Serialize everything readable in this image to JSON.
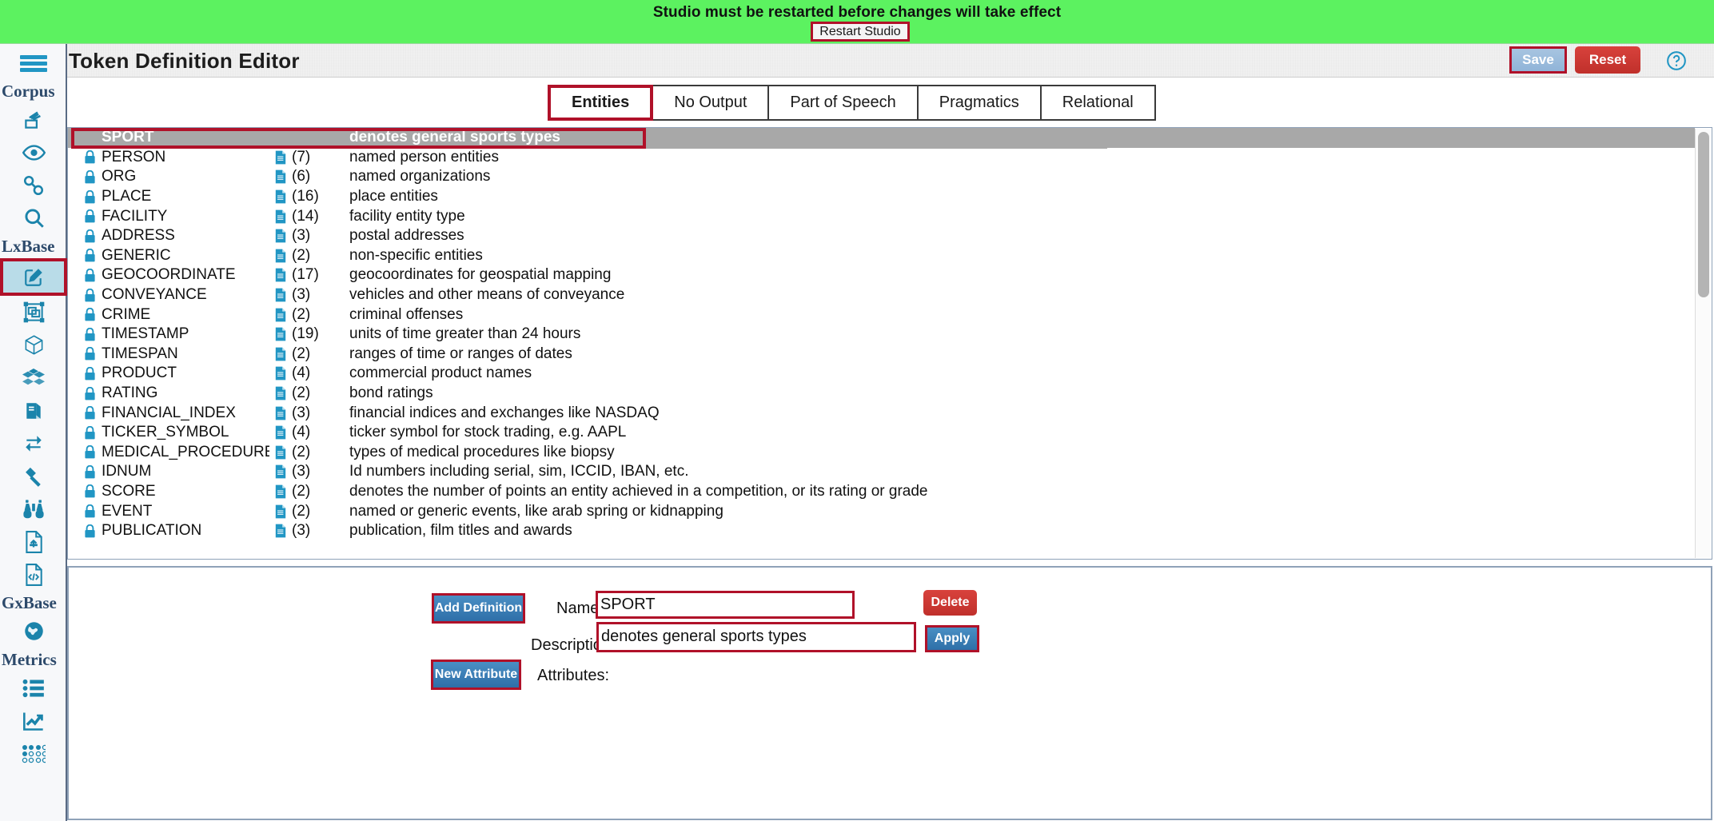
{
  "banner": {
    "message": "Studio must be restarted before changes will take effect",
    "restart_label": "Restart Studio",
    "bg_color": "#5cf260"
  },
  "header": {
    "title": "Token Definition Editor",
    "save_label": "Save",
    "reset_label": "Reset",
    "help_icon": "help-circle-icon"
  },
  "sidebar": {
    "menu_icon": "hamburger-menu-icon",
    "groups": [
      {
        "label": "Corpus",
        "items": [
          {
            "icon": "document-lines-icon",
            "name": "corpus-documents"
          },
          {
            "icon": "eye-icon",
            "name": "corpus-view"
          },
          {
            "icon": "link-chain-icon",
            "name": "corpus-links"
          },
          {
            "icon": "magnifier-icon",
            "name": "corpus-search"
          }
        ]
      },
      {
        "label": "LxBase",
        "items": [
          {
            "icon": "pencil-edit-icon",
            "name": "token-definition-editor"
          },
          {
            "icon": "layers-select-icon",
            "name": "lxbase-layers"
          },
          {
            "icon": "box-3d-icon",
            "name": "lxbase-package"
          },
          {
            "icon": "blocks-icon",
            "name": "lxbase-blocks"
          },
          {
            "icon": "book-icon",
            "name": "lxbase-lexicon"
          },
          {
            "icon": "sync-arrows-icon",
            "name": "lxbase-sync"
          },
          {
            "icon": "gavel-icon",
            "name": "lxbase-rules"
          },
          {
            "icon": "binoculars-icon",
            "name": "lxbase-inspect"
          },
          {
            "icon": "file-upload-icon",
            "name": "lxbase-import"
          },
          {
            "icon": "file-code-icon",
            "name": "lxbase-code"
          }
        ]
      },
      {
        "label": "GxBase",
        "items": [
          {
            "icon": "globe-icon",
            "name": "gxbase-globe"
          }
        ]
      },
      {
        "label": "Metrics",
        "items": [
          {
            "icon": "list-icon",
            "name": "metrics-list"
          },
          {
            "icon": "chart-line-icon",
            "name": "metrics-chart"
          },
          {
            "icon": "dots-grid-icon",
            "name": "metrics-grid"
          }
        ]
      }
    ],
    "active_item": "token-definition-editor"
  },
  "tabs": [
    {
      "label": "Entities",
      "active": true
    },
    {
      "label": "No Output",
      "active": false
    },
    {
      "label": "Part of Speech",
      "active": false
    },
    {
      "label": "Pragmatics",
      "active": false
    },
    {
      "label": "Relational",
      "active": false
    }
  ],
  "definition_list": {
    "lock_icon": "lock-icon",
    "doc_icon": "document-icon",
    "selected_index": 0,
    "rows": [
      {
        "name": "SPORT",
        "count": "",
        "description": "denotes general sports types",
        "selected": true,
        "locked": false,
        "has_doc": false
      },
      {
        "name": "PERSON",
        "count": "(7)",
        "description": "named person entities",
        "selected": false,
        "locked": true,
        "has_doc": true
      },
      {
        "name": "ORG",
        "count": "(6)",
        "description": "named organizations",
        "selected": false,
        "locked": true,
        "has_doc": true
      },
      {
        "name": "PLACE",
        "count": "(16)",
        "description": "place entities",
        "selected": false,
        "locked": true,
        "has_doc": true
      },
      {
        "name": "FACILITY",
        "count": "(14)",
        "description": "facility entity type",
        "selected": false,
        "locked": true,
        "has_doc": true
      },
      {
        "name": "ADDRESS",
        "count": "(3)",
        "description": "postal addresses",
        "selected": false,
        "locked": true,
        "has_doc": true
      },
      {
        "name": "GENERIC",
        "count": "(2)",
        "description": "non-specific entities",
        "selected": false,
        "locked": true,
        "has_doc": true
      },
      {
        "name": "GEOCOORDINATE",
        "count": "(17)",
        "description": "geocoordinates for geospatial mapping",
        "selected": false,
        "locked": true,
        "has_doc": true
      },
      {
        "name": "CONVEYANCE",
        "count": "(3)",
        "description": "vehicles and other means of conveyance",
        "selected": false,
        "locked": true,
        "has_doc": true
      },
      {
        "name": "CRIME",
        "count": "(2)",
        "description": "criminal offenses",
        "selected": false,
        "locked": true,
        "has_doc": true
      },
      {
        "name": "TIMESTAMP",
        "count": "(19)",
        "description": "units of time greater than 24 hours",
        "selected": false,
        "locked": true,
        "has_doc": true
      },
      {
        "name": "TIMESPAN",
        "count": "(2)",
        "description": "ranges of time or ranges of dates",
        "selected": false,
        "locked": true,
        "has_doc": true
      },
      {
        "name": "PRODUCT",
        "count": "(4)",
        "description": "commercial product names",
        "selected": false,
        "locked": true,
        "has_doc": true
      },
      {
        "name": "RATING",
        "count": "(2)",
        "description": "bond ratings",
        "selected": false,
        "locked": true,
        "has_doc": true
      },
      {
        "name": "FINANCIAL_INDEX",
        "count": "(3)",
        "description": "financial indices and exchanges like NASDAQ",
        "selected": false,
        "locked": true,
        "has_doc": true
      },
      {
        "name": "TICKER_SYMBOL",
        "count": "(4)",
        "description": "ticker symbol for stock trading, e.g. AAPL",
        "selected": false,
        "locked": true,
        "has_doc": true
      },
      {
        "name": "MEDICAL_PROCEDURE",
        "count": "(2)",
        "description": "types of medical procedures like biopsy",
        "selected": false,
        "locked": true,
        "has_doc": true
      },
      {
        "name": "IDNUM",
        "count": "(3)",
        "description": "Id numbers including serial, sim, ICCID, IBAN, etc.",
        "selected": false,
        "locked": true,
        "has_doc": true
      },
      {
        "name": "SCORE",
        "count": "(2)",
        "description": "denotes the number of points an entity achieved in a competition, or its rating or grade",
        "selected": false,
        "locked": true,
        "has_doc": true
      },
      {
        "name": "EVENT",
        "count": "(2)",
        "description": "named or generic events, like arab spring or kidnapping",
        "selected": false,
        "locked": true,
        "has_doc": true
      },
      {
        "name": "PUBLICATION",
        "count": "(3)",
        "description": "publication, film titles and awards",
        "selected": false,
        "locked": true,
        "has_doc": true
      }
    ]
  },
  "editor": {
    "add_definition_label": "Add Definition",
    "new_attribute_label": "New Attribute",
    "name_label": "Name:",
    "name_value": "SPORT",
    "description_label": "Description:",
    "description_value": "denotes general sports types",
    "attributes_label": "Attributes:",
    "delete_label": "Delete",
    "apply_label": "Apply"
  },
  "colors": {
    "accent_blue": "#2196c4",
    "highlight_red": "#b01129",
    "danger_red": "#c0302b",
    "banner_green": "#5cf260",
    "selection_gray": "#a8a8a8"
  }
}
